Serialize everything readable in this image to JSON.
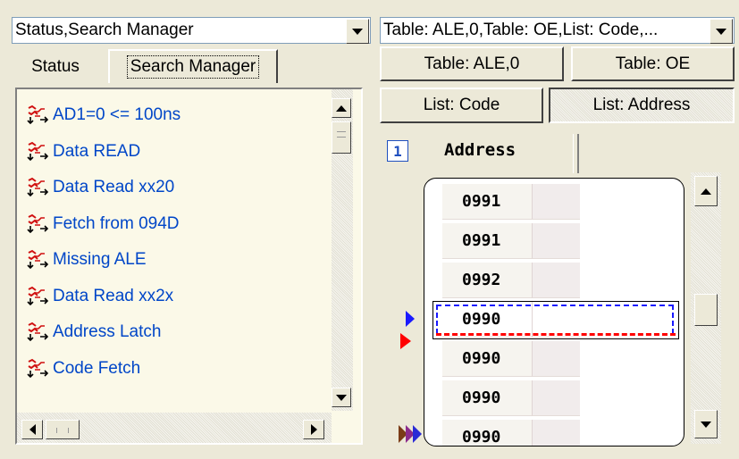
{
  "left_combo": {
    "value": "Status,Search Manager"
  },
  "right_combo": {
    "value": "Table: ALE,0,Table: OE,List: Code,..."
  },
  "tabs": [
    {
      "label": "Status",
      "selected": false
    },
    {
      "label": "Search Manager",
      "selected": true
    }
  ],
  "view_buttons": [
    {
      "label": "Table: ALE,0",
      "pressed": false
    },
    {
      "label": "Table: OE",
      "pressed": false
    },
    {
      "label": "List: Code",
      "pressed": false
    },
    {
      "label": "List: Address",
      "pressed": true
    }
  ],
  "search_items": [
    {
      "label": "AD1=0 <= 100ns",
      "icon": "search-pattern-icon"
    },
    {
      "label": "Data READ",
      "icon": "search-pattern-icon"
    },
    {
      "label": "Data Read xx20",
      "icon": "search-pattern-icon"
    },
    {
      "label": "Fetch from 094D",
      "icon": "search-pattern-icon"
    },
    {
      "label": "Missing ALE",
      "icon": "search-pattern-icon"
    },
    {
      "label": "Data Read xx2x",
      "icon": "search-pattern-icon"
    },
    {
      "label": "Address Latch",
      "icon": "search-pattern-icon"
    },
    {
      "label": "Code Fetch",
      "icon": "search-pattern-icon"
    }
  ],
  "address_panel": {
    "column_number": "1",
    "column_header": "Address",
    "rows": [
      "0991",
      "0991",
      "0992",
      "0990",
      "0990",
      "0990",
      "0990"
    ],
    "selected_row_index": 3
  },
  "colors": {
    "link_text": "#0046c8",
    "marker_blue": "#1a1aff",
    "marker_red": "#ff0000",
    "list_bg": "#fbf9e8"
  }
}
